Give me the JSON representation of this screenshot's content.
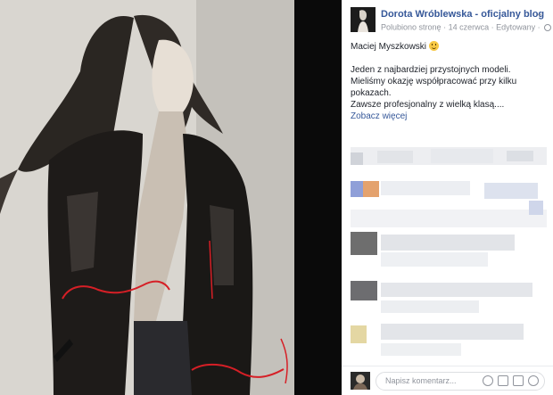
{
  "post": {
    "page_name": "Dorota Wróblewska - oficjalny blog",
    "meta_liked": "Polubiono stronę",
    "meta_date": "14 czerwca",
    "meta_edited": "Edytowany",
    "line1": "Maciej Myszkowski",
    "line2": "Jeden z najbardziej przystojnych modeli.",
    "line3": "Mieliśmy okazję współpracować przy kilku",
    "line4": "pokazach.",
    "line5": "Zawsze profesjonalny z wielką klasą....",
    "see_more": "Zobacz więcej"
  },
  "comment": {
    "placeholder": "Napisz komentarz..."
  },
  "icons": {
    "post_menu": "chevron-down-icon",
    "audience": "globe-icon",
    "emoji": "smiley-icon",
    "camera": "camera-icon",
    "gif": "gif-icon",
    "sticker": "sticker-icon"
  },
  "colors": {
    "link": "#365899",
    "meta": "#90949c",
    "text": "#1d2129"
  }
}
